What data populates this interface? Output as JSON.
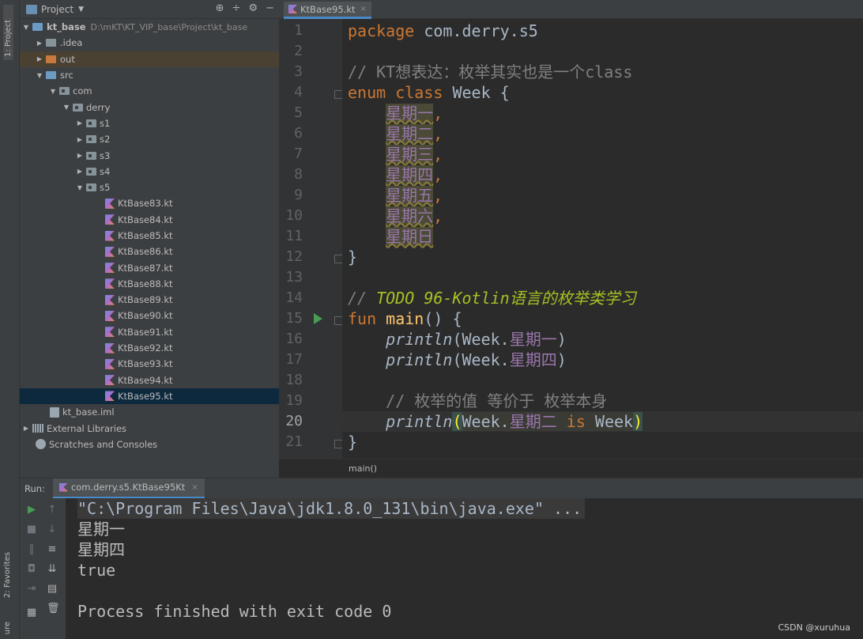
{
  "sidebar_tabs": {
    "project": "1: Project",
    "favorites": "2: Favorites",
    "structure": "ure"
  },
  "project_panel": {
    "title": "Project",
    "tools": [
      "⊕",
      "÷",
      "⚙",
      "−"
    ],
    "tree": [
      {
        "label": "kt_base",
        "path": "D:\\mKT\\KT_VIP_base\\Project\\kt_base"
      },
      {
        "label": ".idea"
      },
      {
        "label": "out"
      },
      {
        "label": "src"
      },
      {
        "label": "com"
      },
      {
        "label": "derry"
      },
      {
        "label": "s1"
      },
      {
        "label": "s2"
      },
      {
        "label": "s3"
      },
      {
        "label": "s4"
      },
      {
        "label": "s5"
      },
      {
        "label": "KtBase83.kt"
      },
      {
        "label": "KtBase84.kt"
      },
      {
        "label": "KtBase85.kt"
      },
      {
        "label": "KtBase86.kt"
      },
      {
        "label": "KtBase87.kt"
      },
      {
        "label": "KtBase88.kt"
      },
      {
        "label": "KtBase89.kt"
      },
      {
        "label": "KtBase90.kt"
      },
      {
        "label": "KtBase91.kt"
      },
      {
        "label": "KtBase92.kt"
      },
      {
        "label": "KtBase93.kt"
      },
      {
        "label": "KtBase94.kt"
      },
      {
        "label": "KtBase95.kt"
      },
      {
        "label": "kt_base.iml"
      },
      {
        "label": "External Libraries"
      },
      {
        "label": "Scratches and Consoles"
      }
    ]
  },
  "editor": {
    "tab_label": "KtBase95.kt",
    "tab_close": "×",
    "line_numbers": [
      "1",
      "2",
      "3",
      "4",
      "5",
      "6",
      "7",
      "8",
      "9",
      "10",
      "11",
      "12",
      "13",
      "14",
      "15",
      "16",
      "17",
      "18",
      "19",
      "20",
      "21"
    ],
    "code": {
      "l1_kw": "package",
      "l1_rest": " com.derry.s5",
      "l3": "// KT想表达：枚举其实也是一个class",
      "l4_enum": "enum",
      "l4_class": "class",
      "l4_rest": " Week {",
      "l5": "星期一",
      "l6": "星期二",
      "l7": "星期三",
      "l8": "星期四",
      "l9": "星期五",
      "l10": "星期六",
      "l11": "星期日",
      "comma": ",",
      "l12": "}",
      "l14_prefix": "// ",
      "l14_todo": "TODO 96-Kotlin语言的枚举类学习",
      "l15_kw": "fun",
      "l15_fn": "main",
      "l15_rest": "() {",
      "println": "println",
      "l16_a": "(Week.",
      "l16_b": "星期一",
      "l16_c": ")",
      "l17_a": "(Week.",
      "l17_b": "星期四",
      "l17_c": ")",
      "l19": "// 枚举的值 等价于 枚举本身",
      "l20_open": "(",
      "l20_week": "Week.",
      "l20_val": "星期二",
      "l20_is": "is",
      "l20_week2": " Week",
      "l20_close": ")",
      "l21": "}"
    },
    "breadcrumb": "main()"
  },
  "run_panel": {
    "label": "Run:",
    "tab_label": "com.derry.s5.KtBase95Kt",
    "tab_close": "×",
    "console": [
      "\"C:\\Program Files\\Java\\jdk1.8.0_131\\bin\\java.exe\" ...",
      "星期一",
      "星期四",
      "true",
      "",
      "Process finished with exit code 0"
    ]
  },
  "watermark": "CSDN @xuruhua",
  "colors": {
    "keyword": "#cc7832",
    "enum_constant": "#9876aa",
    "function": "#ffc66d",
    "comment": "#808080",
    "todo": "#a8c023",
    "background": "#2b2b2b",
    "panel": "#3c3f41"
  }
}
